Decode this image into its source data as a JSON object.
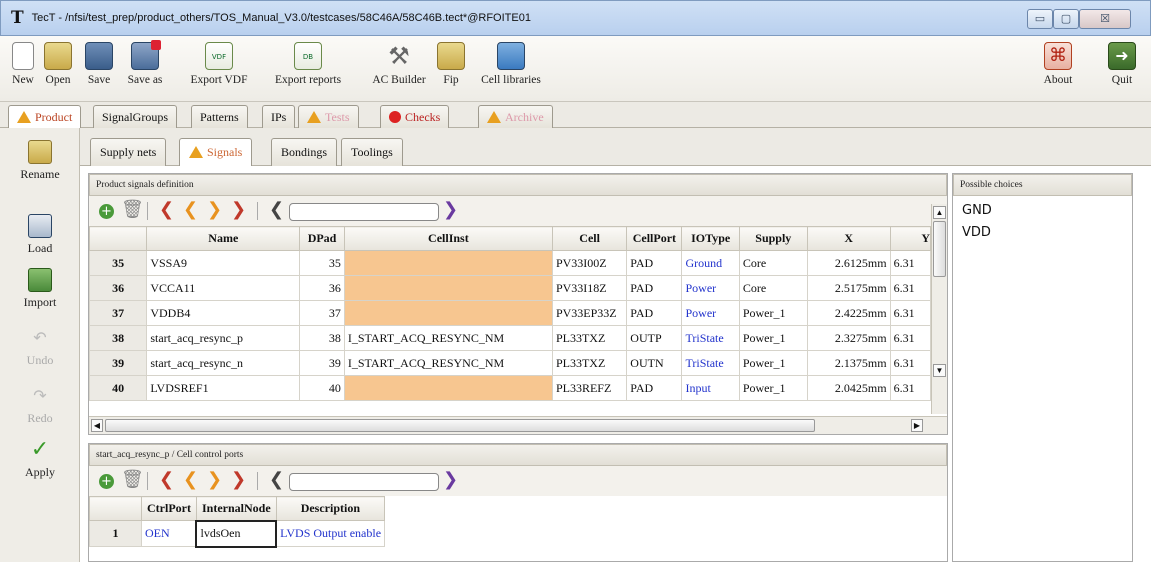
{
  "window": {
    "logo": "T",
    "title": "TecT - /nfsi/test_prep/product_others/TOS_Manual_V3.0/testcases/58C46A/58C46B.tect*@RFOITE01",
    "minimize_icon": "minimize-icon",
    "maximize_icon": "maximize-icon",
    "close_label": "☒"
  },
  "toolbar": {
    "items": [
      {
        "label": "New",
        "icon": "new-document-icon"
      },
      {
        "label": "Open",
        "icon": "folder-open-icon"
      },
      {
        "label": "Save",
        "icon": "save-disk-icon"
      },
      {
        "label": "Save as",
        "icon": "save-as-icon"
      },
      {
        "label": "Export VDF",
        "icon": "export-vdf-icon",
        "glyph": "VDF"
      },
      {
        "label": "Export reports",
        "icon": "export-reports-icon",
        "glyph": "DB"
      },
      {
        "label": "AC Builder",
        "icon": "tools-icon",
        "glyph": "⚒"
      },
      {
        "label": "Fip",
        "icon": "fip-folder-icon"
      },
      {
        "label": "Cell libraries",
        "icon": "cell-libraries-icon"
      }
    ],
    "about": {
      "label": "About",
      "icon": "about-lifebuoy-icon",
      "glyph": "⌘"
    },
    "quit": {
      "label": "Quit",
      "icon": "quit-door-icon",
      "glyph": "➜"
    }
  },
  "main_tabs": [
    {
      "label": "Product",
      "warn": true,
      "active": true
    },
    {
      "label": "SignalGroups"
    },
    {
      "label": "Patterns"
    },
    {
      "label": "IPs"
    },
    {
      "label": "Tests",
      "warn": true,
      "faded": true
    },
    {
      "label": "Checks",
      "stop": true
    },
    {
      "label": "Archive",
      "warn": true,
      "faded": true
    }
  ],
  "sidebar": [
    {
      "label": "Rename",
      "icon": "rename-icon"
    },
    {
      "label": "Load",
      "icon": "load-icon"
    },
    {
      "label": "Import",
      "icon": "import-icon"
    },
    {
      "label": "Undo",
      "icon": "undo-icon",
      "disabled": true
    },
    {
      "label": "Redo",
      "icon": "redo-icon",
      "disabled": true
    },
    {
      "label": "Apply",
      "icon": "apply-check-icon",
      "glyph": "✓"
    }
  ],
  "sub_tabs": [
    {
      "label": "Supply nets"
    },
    {
      "label": "Signals",
      "warn": true,
      "active": true
    },
    {
      "label": "Bondings"
    },
    {
      "label": "Toolings"
    }
  ],
  "signals_panel": {
    "title": "Product signals definition",
    "columns": [
      "Name",
      "DPad",
      "CellInst",
      "Cell",
      "CellPort",
      "IOType",
      "Supply",
      "X",
      "Y"
    ],
    "rows": [
      {
        "row": "35",
        "name": "VSSA9",
        "dpad": "35",
        "cellinst": "",
        "cell": "PV33I00Z",
        "cellport": "PAD",
        "iotype": "Ground",
        "supply": "Core",
        "x": "2.6125mm",
        "y": "6.31"
      },
      {
        "row": "36",
        "name": "VCCA11",
        "dpad": "36",
        "cellinst": "",
        "cell": "PV33I18Z",
        "cellport": "PAD",
        "iotype": "Power",
        "supply": "Core",
        "x": "2.5175mm",
        "y": "6.31"
      },
      {
        "row": "37",
        "name": "VDDB4",
        "dpad": "37",
        "cellinst": "",
        "cell": "PV33EP33Z",
        "cellport": "PAD",
        "iotype": "Power",
        "supply": "Power_1",
        "x": "2.4225mm",
        "y": "6.31"
      },
      {
        "row": "38",
        "name": "start_acq_resync_p",
        "dpad": "38",
        "cellinst": "I_START_ACQ_RESYNC_NM",
        "cell": "PL33TXZ",
        "cellport": "OUTP",
        "iotype": "TriState",
        "supply": "Power_1",
        "x": "2.3275mm",
        "y": "6.31"
      },
      {
        "row": "39",
        "name": "start_acq_resync_n",
        "dpad": "39",
        "cellinst": "I_START_ACQ_RESYNC_NM",
        "cell": "PL33TXZ",
        "cellport": "OUTN",
        "iotype": "TriState",
        "supply": "Power_1",
        "x": "2.1375mm",
        "y": "6.31"
      },
      {
        "row": "40",
        "name": "LVDSREF1",
        "dpad": "40",
        "cellinst": "",
        "cell": "PL33REFZ",
        "cellport": "PAD",
        "iotype": "Input",
        "supply": "Power_1",
        "x": "2.0425mm",
        "y": "6.31"
      }
    ]
  },
  "choices_panel": {
    "title": "Possible choices",
    "items": [
      "GND",
      "VDD"
    ]
  },
  "ctrl_panel": {
    "title": "start_acq_resync_p / Cell control ports",
    "columns": [
      "CtrlPort",
      "InternalNode",
      "Description"
    ],
    "rows": [
      {
        "row": "1",
        "ctrlport": "OEN",
        "internalnode": "lvdsOen",
        "description": "LVDS Output enable"
      }
    ]
  },
  "colors": {
    "orange_cell": "#f7c690",
    "link_blue": "#2233cc",
    "warn_yellow": "#e8a020"
  }
}
